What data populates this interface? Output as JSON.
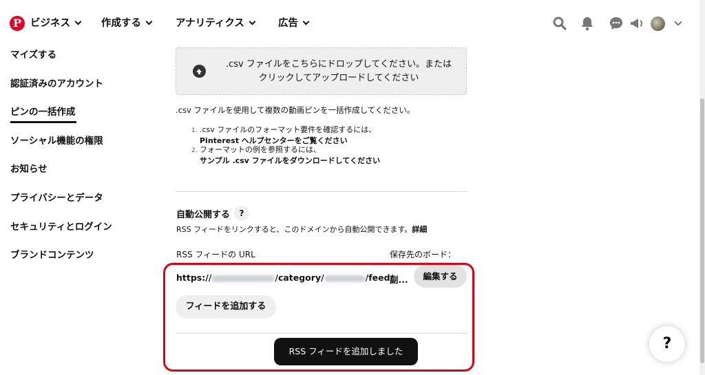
{
  "nav": {
    "business": "ビジネス",
    "create": "作成する",
    "analytics": "アナリティクス",
    "ads": "広告",
    "icons": [
      "search-icon",
      "bell-icon",
      "chat-icon",
      "megaphone-icon",
      "avatar",
      "chevron-down-icon"
    ],
    "brand_color": "#e60023"
  },
  "sidebar": {
    "items": [
      {
        "label": "マイズする"
      },
      {
        "label": "認証済みのアカウント"
      },
      {
        "label": "ピンの一括作成",
        "active": true
      },
      {
        "label": "ソーシャル機能の権限"
      },
      {
        "label": "お知らせ"
      },
      {
        "label": "プライバシーとデータ"
      },
      {
        "label": "セキュリティとログイン"
      },
      {
        "label": "ブランドコンテンツ"
      }
    ]
  },
  "upload": {
    "line1": ".csv ファイルをこちらにドロップしてください。または",
    "line2": "クリックしてアップロードしてください"
  },
  "bulk": {
    "description": ".csv ファイルを使用して複数の動画ピンを一括作成してください。",
    "step1_num": "1.",
    "step1_text": ".csv ファイルのフォーマット要件を確認するには、",
    "step1_link_prefix": "Pinterest",
    "step1_link": "ヘルプセンターをご覧ください",
    "step2_num": "2.",
    "step2_text": "フォーマットの例を参照するには、",
    "step2_link": "サンプル .csv ファイルをダウンロードしてください"
  },
  "auto_publish": {
    "title": "自動公開する",
    "help": "?",
    "description": "RSS フィードをリンクすると、このドメインから自動公開できます。",
    "details_link": "詳細",
    "url_label": "RSS フィードの URL",
    "board_label": "保存先のボード：",
    "feed_prefix": "https://",
    "feed_mid": "/category/",
    "feed_suffix": "/feed/",
    "board_name": "副...",
    "edit_button": "編集する",
    "add_feed_button": "フィードを追加する"
  },
  "toast": {
    "message": "RSS フィードを追加しました"
  },
  "help_fab": "?"
}
